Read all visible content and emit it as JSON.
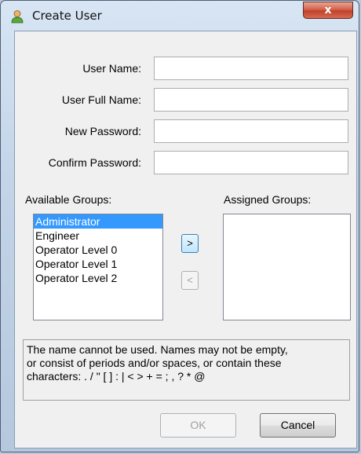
{
  "window": {
    "title": "Create User",
    "close_glyph": "x"
  },
  "form": {
    "user_name_label": "User Name:",
    "user_full_name_label": "User Full Name:",
    "new_password_label": "New Password:",
    "confirm_password_label": "Confirm Password:",
    "user_name_value": "",
    "user_full_name_value": "",
    "new_password_value": "",
    "confirm_password_value": ""
  },
  "groups": {
    "available_label": "Available Groups:",
    "assigned_label": "Assigned Groups:",
    "available": [
      "Administrator",
      "Engineer",
      "Operator Level 0",
      "Operator Level 1",
      "Operator Level 2"
    ],
    "assigned": [],
    "selected_available": "Administrator",
    "add_glyph": ">",
    "remove_glyph": "<"
  },
  "message": {
    "lines": [
      "The name cannot be used. Names may not be empty,",
      "or consist of periods and/or spaces, or contain these",
      "characters: . / \" [ ] : | < > + = ; , ? * @"
    ]
  },
  "buttons": {
    "ok_label": "OK",
    "cancel_label": "Cancel"
  },
  "icons": {
    "app": "user-icon"
  },
  "colors": {
    "selection": "#3399ff",
    "close_button": "#c2412b"
  }
}
